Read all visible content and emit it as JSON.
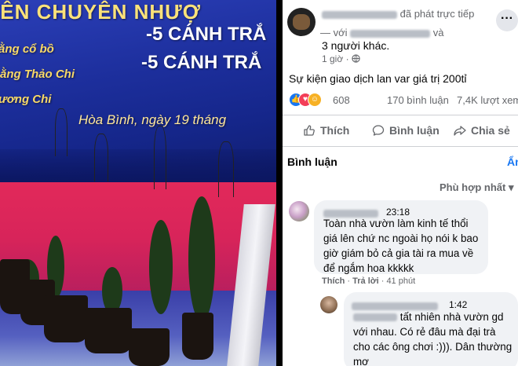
{
  "photo": {
    "banner_line1": "IÊN CHUYÊN NHƯỢ",
    "banner_line2": "-5 CÁNH TRẮ",
    "banner_line3": "ằng cổ bồ",
    "banner_line4": "-5 CÁNH TRẮ",
    "banner_line5": "ằng Thảo Chi",
    "banner_line6": "ương Chi",
    "banner_location": "Hòa Bình, ngày 19 tháng"
  },
  "post": {
    "header_action": "đã phát trực tiếp",
    "with_prefix": "— với",
    "and_text": "và",
    "others_text": "3 người khác.",
    "time": "1 giờ",
    "globe_icon": "globe-icon",
    "text": "Sự kiện giao dịch lan var giá trị 200tỉ",
    "reaction_count": "608",
    "comment_count": "170 bình luận",
    "view_count": "7,4K lượt xem",
    "actions": {
      "like": "Thích",
      "comment": "Bình luận",
      "share": "Chia sẻ"
    }
  },
  "comments_section": {
    "title": "Bình luận",
    "hide_label": "Ẩn",
    "sort_label": "Phù hợp nhất"
  },
  "comments": [
    {
      "time": "23:18",
      "text": "Toàn nhà vườn làm kinh tế thổi giá lên chứ nc ngoài họ nói k bao giờ giám bỏ cả gia tài ra mua về để ngắm hoa kkkkk",
      "like_label": "Thích",
      "reply_label": "Trả lời",
      "age": "41 phút"
    },
    {
      "time": "1:42",
      "text": "tất nhiên nhà vườn gd với nhau. Có rẻ đâu mà đại trà cho các ông chơi :))). Dân thường mơ"
    }
  ],
  "colors": {
    "link_blue": "#1877f2",
    "secondary_text": "#65676b",
    "bubble_bg": "#f0f2f5"
  }
}
